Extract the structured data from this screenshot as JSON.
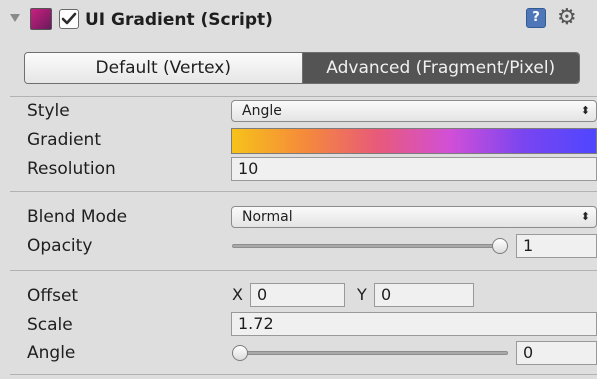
{
  "component": {
    "title": "UI Gradient (Script)",
    "enabled": true,
    "help_icon": "?",
    "icons": [
      "foldout-arrow-icon",
      "component-color-icon",
      "checkbox-icon",
      "help-book-icon",
      "gear-icon"
    ]
  },
  "mode_toggle": {
    "options": [
      "Default (Vertex)",
      "Advanced (Fragment/Pixel)"
    ],
    "selected": "Advanced (Fragment/Pixel)"
  },
  "fields": {
    "style": {
      "label": "Style",
      "value": "Angle"
    },
    "gradient": {
      "label": "Gradient",
      "colors": [
        "#f7c21a",
        "#f58a3a",
        "#e85a7a",
        "#d14fd8",
        "#7a45f0",
        "#4f46ff"
      ]
    },
    "resolution": {
      "label": "Resolution",
      "value": "10"
    },
    "blend_mode": {
      "label": "Blend Mode",
      "value": "Normal"
    },
    "opacity": {
      "label": "Opacity",
      "value": "1",
      "level": 1.0
    },
    "offset": {
      "label": "Offset",
      "x_label": "X",
      "x": "0",
      "y_label": "Y",
      "y": "0"
    },
    "scale": {
      "label": "Scale",
      "value": "1.72"
    },
    "angle": {
      "label": "Angle",
      "value": "0",
      "level": 0.0
    }
  }
}
